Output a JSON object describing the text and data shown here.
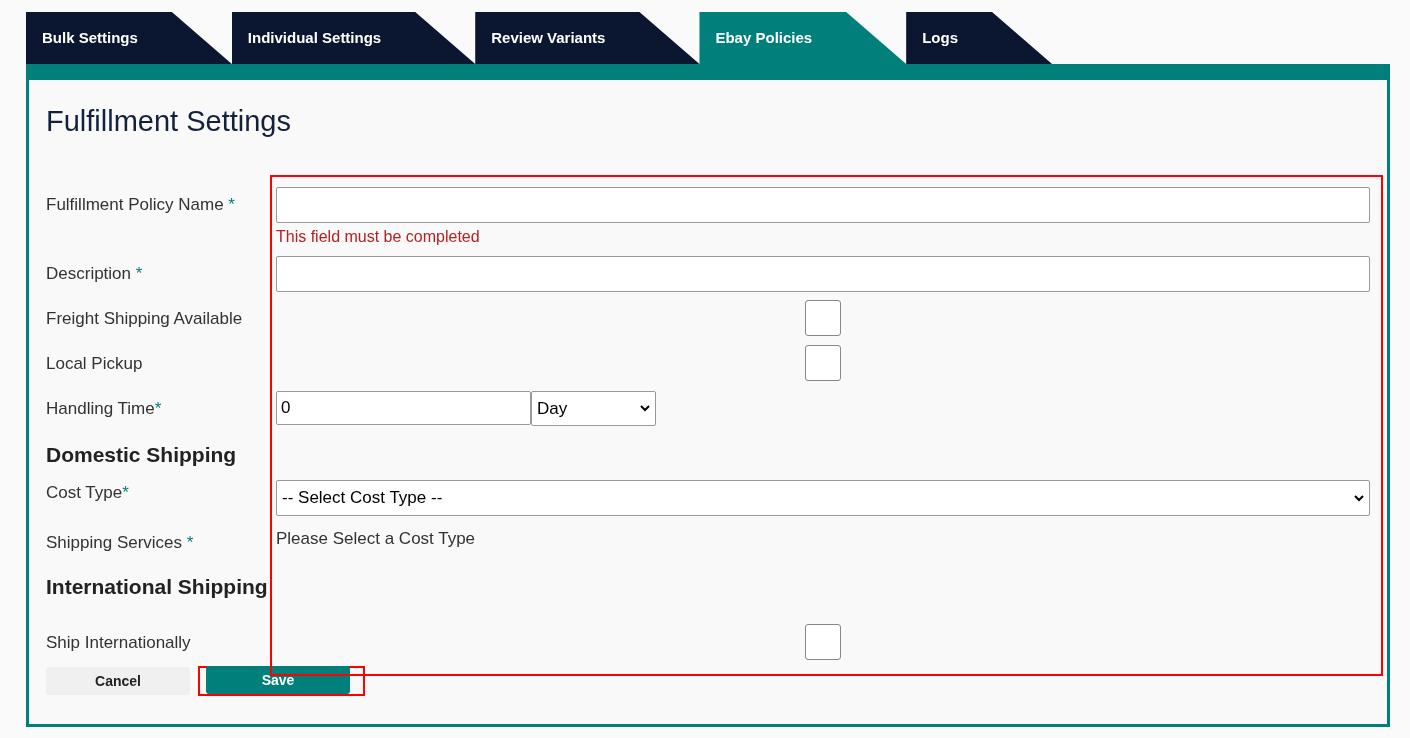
{
  "tabs": [
    {
      "label": "Bulk Settings",
      "selected": false
    },
    {
      "label": "Individual Settings",
      "selected": false
    },
    {
      "label": "Review Variants",
      "selected": false
    },
    {
      "label": "Ebay Policies",
      "selected": true
    },
    {
      "label": "Logs",
      "selected": false
    }
  ],
  "title": "Fulfillment Settings",
  "rows": [
    {
      "kind": "text",
      "label": "Fulfillment Policy Name ",
      "mark": "*",
      "value": "",
      "error": "This field must be completed"
    },
    {
      "kind": "text",
      "label": "Description ",
      "mark": "*",
      "value": ""
    },
    {
      "kind": "checkbox",
      "label": "Freight Shipping Available",
      "checked": false
    },
    {
      "kind": "checkbox",
      "label": "Local Pickup",
      "checked": false
    },
    {
      "kind": "handling",
      "label": "Handling Time",
      "mark": "*",
      "value": "0",
      "unit": "Day"
    },
    {
      "kind": "heading",
      "label": "Domestic Shipping"
    },
    {
      "kind": "select",
      "label": "Cost Type",
      "mark": "*",
      "value": "-- Select Cost Type --"
    },
    {
      "kind": "note",
      "label": "Shipping Services ",
      "mark": "*",
      "note": "Please Select a Cost Type"
    },
    {
      "kind": "heading",
      "label": "International Shipping"
    },
    {
      "kind": "checkbox",
      "label": "Ship Internationally",
      "checked": false
    }
  ],
  "buttons": [
    {
      "label": "Cancel",
      "kind": "secondary",
      "highlighted": false
    },
    {
      "label": "Save",
      "kind": "primary",
      "highlighted": true
    }
  ]
}
